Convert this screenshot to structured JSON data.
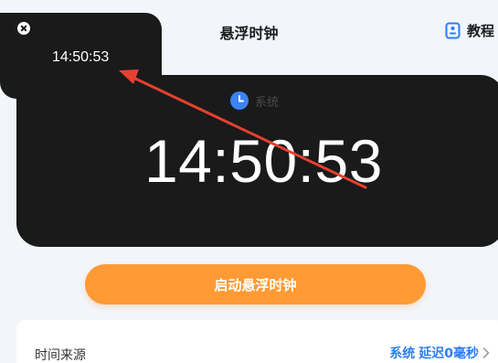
{
  "header": {
    "title": "悬浮时钟",
    "tutorial_label": "教程",
    "tutorial_icon": "document-icon"
  },
  "clock_card": {
    "source_icon": "clock-icon",
    "source_label": "系统",
    "time": "14:50:53"
  },
  "floating_window": {
    "close_icon": "close-icon",
    "time": "14:50:53"
  },
  "annotation": {
    "arrow_color": "#e8402f"
  },
  "start_button": {
    "label": "启动悬浮时钟"
  },
  "settings": {
    "time_source_label": "时间来源",
    "time_source_value": "系统",
    "delay_value": "延迟0毫秒"
  },
  "colors": {
    "accent_orange": "#ff9a35",
    "link_blue": "#2d7df6",
    "card_dark": "#1a1a1a",
    "background": "#f2f5fa"
  }
}
